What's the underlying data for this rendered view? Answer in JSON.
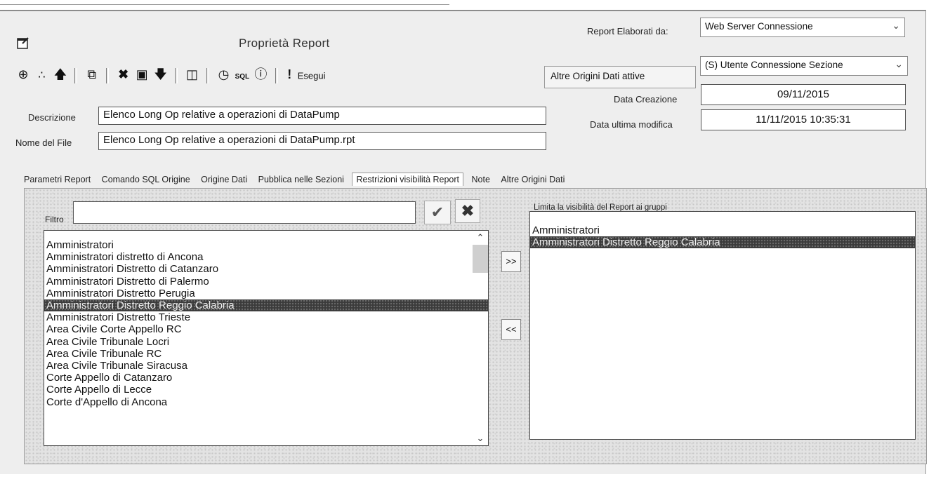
{
  "window": {
    "title": "Proprietà Report"
  },
  "header": {
    "report_by_label": "Report Elaborati da:",
    "report_by_value": "Web Server Connessione",
    "other_sources_button": "Altre Origini Dati attive",
    "other_sources_value": "(S) Utente Connessione Sezione",
    "creation_date_label": "Data Creazione",
    "creation_date_value": "09/11/2015",
    "last_modified_label": "Data ultima modifica",
    "last_modified_value": "11/11/2015 10:35:31"
  },
  "toolbar": {
    "execute_label": "Esegui"
  },
  "form": {
    "description_label": "Descrizione",
    "description_value": "Elenco Long Op relative a operazioni di DataPump",
    "filename_label": "Nome del File",
    "filename_value": "Elenco Long Op relative a operazioni di DataPump.rpt"
  },
  "tabs": [
    {
      "label": "Parametri Report"
    },
    {
      "label": "Comando SQL Origine"
    },
    {
      "label": "Origine Dati"
    },
    {
      "label": "Pubblica nelle Sezioni"
    },
    {
      "label": "Restrizioni visibilità Report"
    },
    {
      "label": "Note"
    },
    {
      "label": "Altre Origini Dati"
    }
  ],
  "restrictions": {
    "filter_label": "Filtro",
    "filter_value": "",
    "add_button": ">>",
    "remove_button": "<<",
    "limit_label": "Limita la visibilità del Report ai gruppi",
    "available_groups": [
      "Amministratori",
      "Amministratori distretto di Ancona",
      "Amministratori Distretto di Catanzaro",
      "Amministratori Distretto di Palermo",
      "Amministratori Distretto Perugia",
      "Amministratori Distretto Reggio Calabria",
      "Amministratori Distretto Trieste",
      "Area Civile Corte Appello RC",
      "Area Civile Tribunale Locri",
      "Area Civile Tribunale RC",
      "Area Civile Tribunale Siracusa",
      "Corte Appello di Catanzaro",
      "Corte Appello di Lecce",
      "Corte d'Appello di Ancona"
    ],
    "available_selected_index": 5,
    "selected_groups": [
      "Amministratori",
      "Amministratori Distretto Reggio Calabria"
    ],
    "selected_selected_index": 1
  }
}
